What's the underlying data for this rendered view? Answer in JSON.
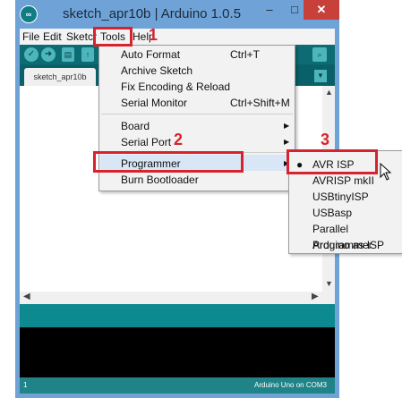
{
  "window": {
    "title": "sketch_apr10b | Arduino 1.0.5",
    "app_icon": "arduino-logo-icon",
    "controls": {
      "minimize": "–",
      "maximize": "□",
      "close": "✕"
    }
  },
  "menubar": [
    "File",
    "Edit",
    "Sketch",
    "Tools",
    "Help"
  ],
  "toolbar": {
    "buttons": [
      "verify-icon",
      "upload-icon",
      "new-icon",
      "open-icon",
      "save-icon"
    ],
    "serial_monitor_icon": "magnifier-icon"
  },
  "tab": {
    "label": "sketch_apr10b"
  },
  "tools_menu": {
    "items": [
      {
        "label": "Auto Format",
        "shortcut": "Ctrl+T"
      },
      {
        "label": "Archive Sketch",
        "shortcut": ""
      },
      {
        "label": "Fix Encoding & Reload",
        "shortcut": ""
      },
      {
        "label": "Serial Monitor",
        "shortcut": "Ctrl+Shift+M"
      },
      {
        "label": "Board",
        "shortcut": ""
      },
      {
        "label": "Serial Port",
        "shortcut": ""
      },
      {
        "label": "Programmer",
        "shortcut": ""
      },
      {
        "label": "Burn Bootloader",
        "shortcut": ""
      }
    ]
  },
  "programmer_submenu": {
    "selected": "AVR ISP",
    "items": [
      "AVR ISP",
      "AVRISP mkII",
      "USBtinyISP",
      "USBasp",
      "Parallel Programmer",
      "Arduino as ISP"
    ]
  },
  "annotations": [
    "1",
    "2",
    "3"
  ],
  "statusbar": {
    "line": "1",
    "board": "Arduino Uno on COM3"
  },
  "colors": {
    "teal_dark": "#0d6c73",
    "teal": "#0d8a8f",
    "annotation_red": "#d6232d"
  }
}
